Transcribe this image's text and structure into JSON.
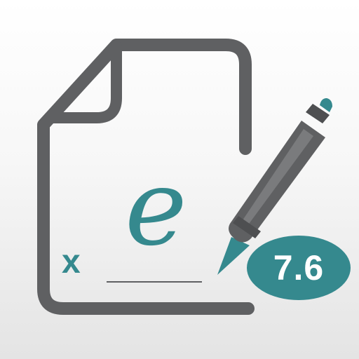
{
  "app_icon": {
    "signature_mark": "x",
    "signature_letter": "e",
    "version": "7.6",
    "icons": [
      "document-icon",
      "pen-icon"
    ]
  },
  "colors": {
    "teal": "#35898e",
    "gray": "#5f6062",
    "background": "#f5f5f5"
  }
}
